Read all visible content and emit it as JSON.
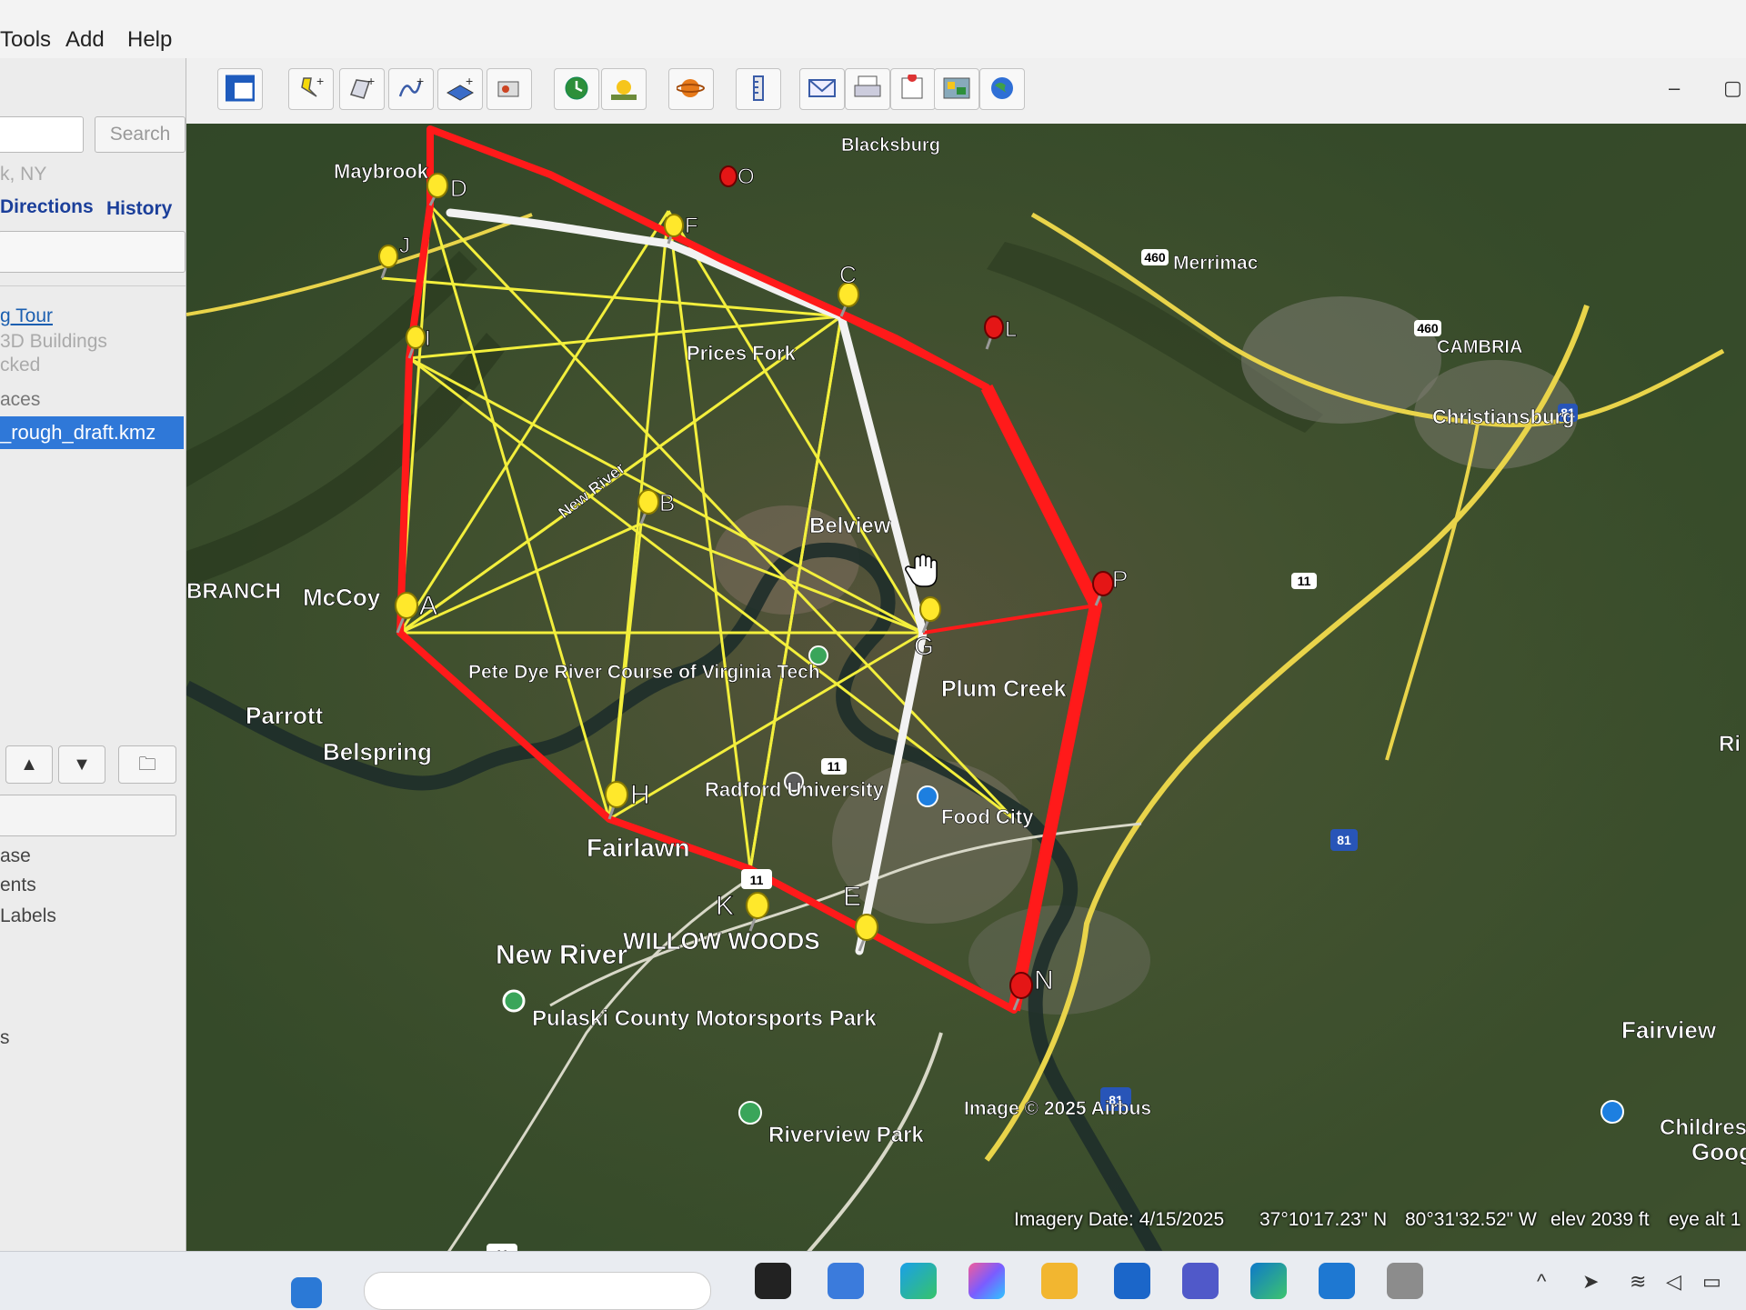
{
  "menu": {
    "tools": "Tools",
    "add": "Add",
    "help": "Help"
  },
  "window": {
    "minimize": "–",
    "maximize": "▢"
  },
  "sidebar": {
    "search_button": "Search",
    "location_hint": "k, NY",
    "tabs": {
      "directions": "Directions",
      "history": "History"
    },
    "places": {
      "tour_link": "g Tour",
      "buildings": "3D Buildings",
      "checked": "cked",
      "places_header": "aces",
      "file": "_rough_draft.kmz"
    },
    "layers": {
      "database": "ase",
      "elements": "ents",
      "labels": " Labels",
      "misc": "s"
    }
  },
  "map": {
    "places": {
      "maybrook": "Maybrook",
      "blacksburg": "Blacksburg",
      "merrimac": "Merrimac",
      "cambria": "CAMBRIA",
      "christiansburg": "Christiansburg",
      "prices_fork": "Prices Fork",
      "belview": "Belview",
      "new_river_label": "New River",
      "branch": "BRANCH",
      "mccoy": "McCoy",
      "pete_dye": "Pete Dye River Course of Virginia Tech",
      "plum_creek": "Plum Creek",
      "parrott": "Parrott",
      "belspring": "Belspring",
      "radford": "Radford University",
      "food_city": "Food City",
      "fairlawn": "Fairlawn",
      "willow_woods": "WILLOW WOODS",
      "new_river_town": "New River",
      "pulaski": "Pulaski County Motorsports Park",
      "riverview": "Riverview Park",
      "fairview": "Fairview",
      "childrens": "Childres",
      "goog": "Goog",
      "ri": "Ri"
    },
    "shields": {
      "us460a": "460",
      "us460b": "460",
      "us11a": "11",
      "us11b": "11",
      "us11c": "11",
      "us11d": "11",
      "i81a": "81",
      "i81b": "81",
      "i81c": "81"
    },
    "pins": {
      "a": "A",
      "b": "B",
      "c": "C",
      "d": "D",
      "e": "E",
      "f": "F",
      "g": "G",
      "h": "H",
      "i": "I",
      "j": "J",
      "k": "K",
      "l": "L",
      "n": "N",
      "o": "O",
      "p": "P"
    },
    "attribution": "Image © 2025 Airbus"
  },
  "status": {
    "imagery_date": "Imagery Date: 4/15/2025",
    "latitude": "37°10'17.23\" N",
    "longitude": "80°31'32.52\" W",
    "elevation": "elev  2039 ft",
    "eye_alt": "eye alt  1"
  },
  "colors": {
    "boundary": "#ff1a1a",
    "star_lines": "#f3ef3c",
    "white_path": "#f2f2f2",
    "pin_yellow": "#ffe82b",
    "pin_red": "#e41616",
    "selected": "#2f78d8"
  }
}
